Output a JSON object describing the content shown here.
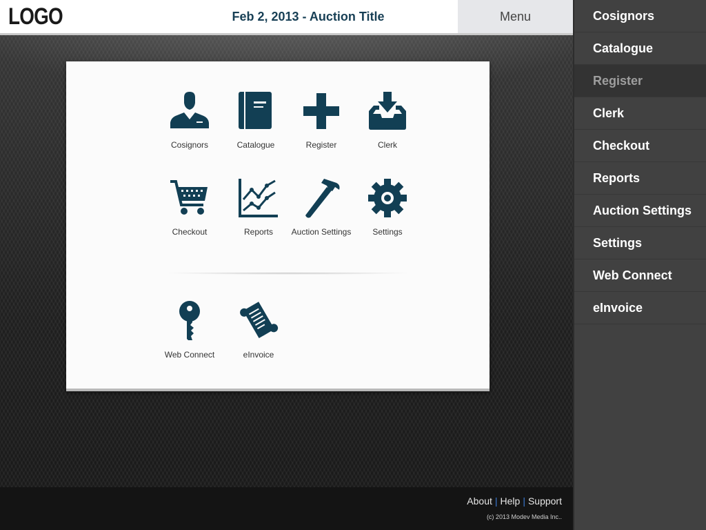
{
  "header": {
    "logo": "LOGO",
    "title": "Feb 2, 2013 - Auction Title",
    "menu_label": "Menu"
  },
  "tiles": [
    {
      "label": "Cosignors",
      "icon": "person-icon"
    },
    {
      "label": "Catalogue",
      "icon": "book-icon"
    },
    {
      "label": "Register",
      "icon": "plus-icon"
    },
    {
      "label": "Clerk",
      "icon": "inbox-download-icon"
    },
    {
      "label": "Checkout",
      "icon": "shopping-cart-icon"
    },
    {
      "label": "Reports",
      "icon": "line-chart-icon"
    },
    {
      "label": "Auction Settings",
      "icon": "hammer-icon"
    },
    {
      "label": "Settings",
      "icon": "gear-icon"
    },
    {
      "label": "Web Connect",
      "icon": "key-icon"
    },
    {
      "label": "eInvoice",
      "icon": "scroll-icon"
    }
  ],
  "footer": {
    "links": [
      "About",
      "Help",
      "Support"
    ],
    "separator": "|",
    "copyright": "(c) 2013 Modev Media Inc.."
  },
  "sidebar": {
    "active_index": 2,
    "items": [
      {
        "label": "Cosignors"
      },
      {
        "label": "Catalogue"
      },
      {
        "label": "Register"
      },
      {
        "label": "Clerk"
      },
      {
        "label": "Checkout"
      },
      {
        "label": "Reports"
      },
      {
        "label": "Auction Settings"
      },
      {
        "label": "Settings"
      },
      {
        "label": "Web Connect"
      },
      {
        "label": "eInvoice"
      }
    ]
  },
  "colors": {
    "icon": "#123f54",
    "title": "#173f55",
    "sidebar_bg": "#414141",
    "sidebar_active_bg": "#333333",
    "sidebar_active_text": "#9e9e9e",
    "footer_separator": "#3a7bd5"
  }
}
